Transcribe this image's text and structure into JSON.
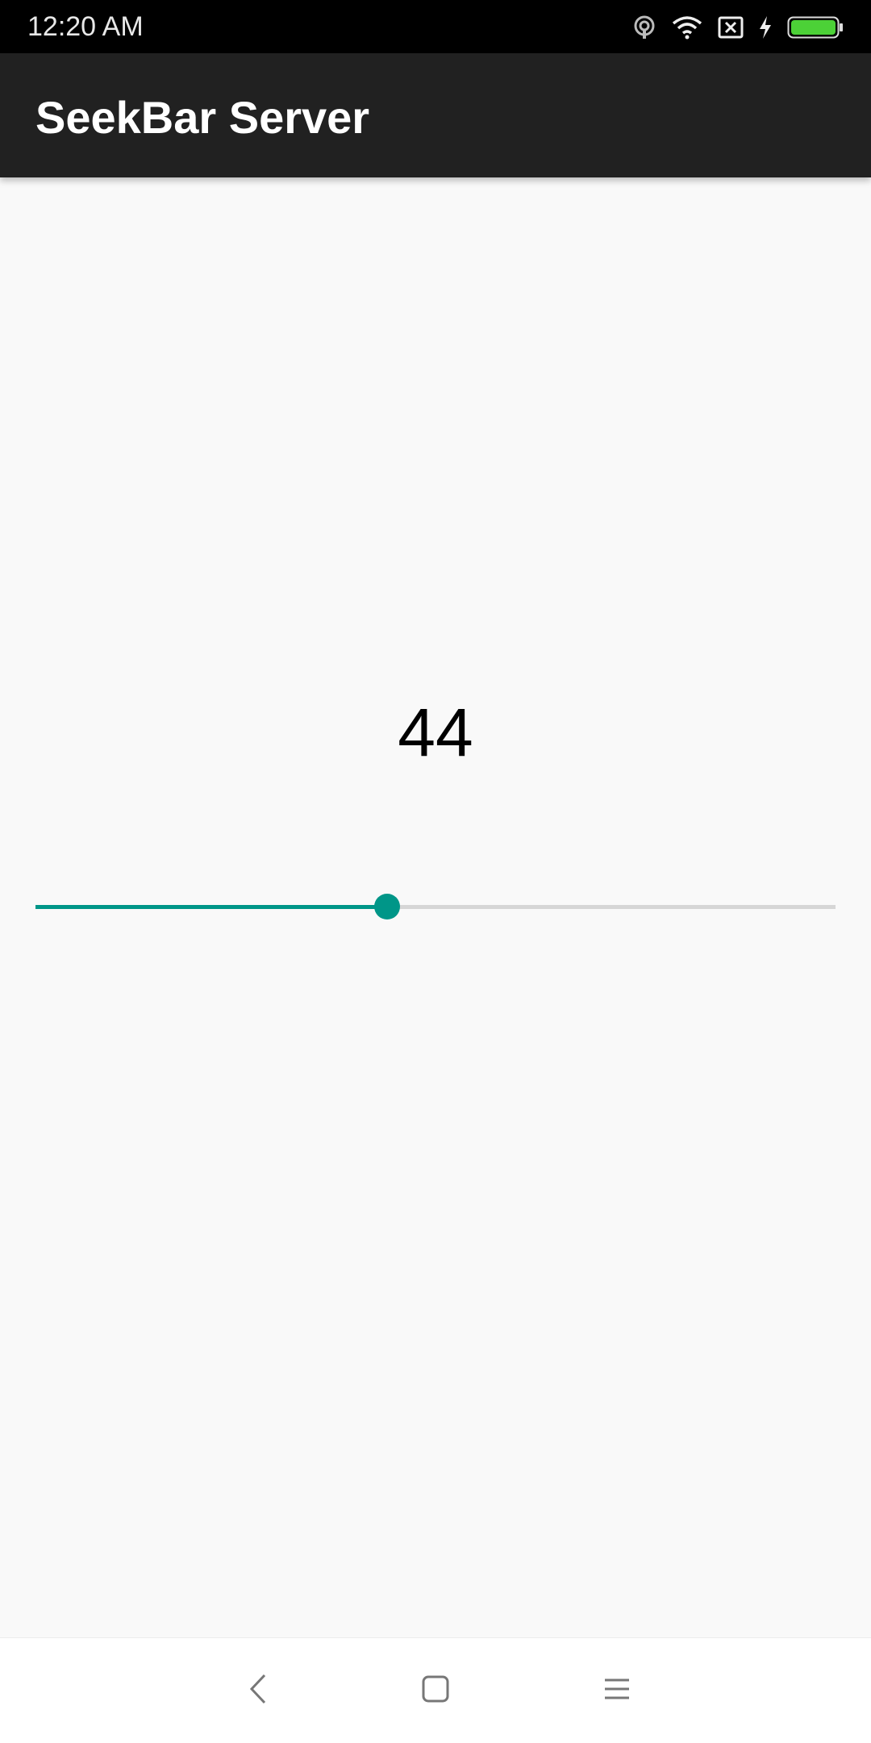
{
  "status_bar": {
    "time": "12:20  AM",
    "icons": [
      "hotspot-icon",
      "wifi-icon",
      "sim-x-icon",
      "charging-bolt-icon",
      "battery-icon"
    ],
    "battery_color": "#4cd137"
  },
  "app_bar": {
    "title": "SeekBar Server",
    "background": "#212121"
  },
  "main": {
    "value_label": "44",
    "seekbar": {
      "progress": 44,
      "max": 100,
      "accent_color": "#009688",
      "track_color": "#d6d6d6"
    }
  },
  "nav_bar": {
    "icons": [
      "back-icon",
      "home-icon",
      "menu-icon"
    ]
  }
}
